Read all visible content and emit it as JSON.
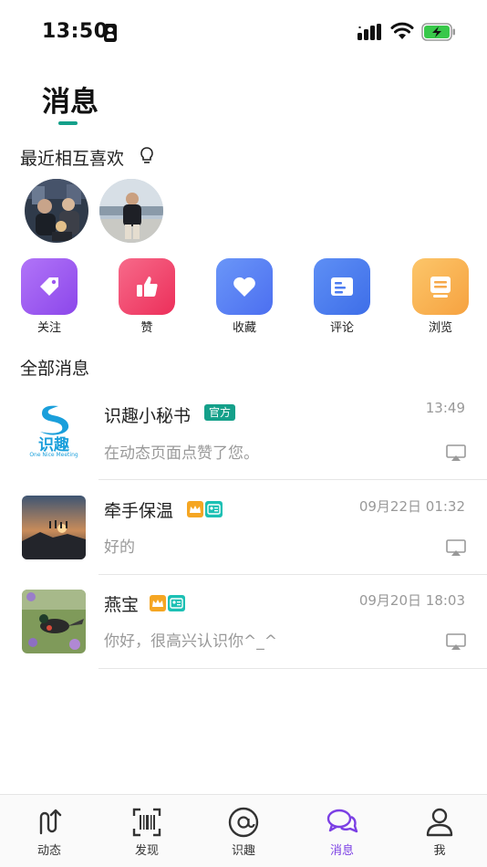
{
  "status_bar": {
    "time": "13:50"
  },
  "header": {
    "title": "消息"
  },
  "mutual_likes": {
    "title": "最近相互喜欢"
  },
  "categories": [
    {
      "label": "关注",
      "icon": "tag-icon",
      "color": "#a05ef2"
    },
    {
      "label": "赞",
      "icon": "thumbs-up-icon",
      "color": "#f04a6e"
    },
    {
      "label": "收藏",
      "icon": "heart-icon",
      "color": "#5a84f5"
    },
    {
      "label": "评论",
      "icon": "comment-card-icon",
      "color": "#4f80f0"
    },
    {
      "label": "浏览",
      "icon": "browse-card-icon",
      "color": "#f9b154"
    }
  ],
  "all_messages": {
    "title": "全部消息"
  },
  "messages": [
    {
      "name": "识趣小秘书",
      "badge": "官方",
      "time": "13:49",
      "text": "在动态页面点赞了您。",
      "logo_text": "识趣",
      "logo_subtitle": "One Nice Meeting"
    },
    {
      "name": "牵手保温",
      "time": "09月22日 01:32",
      "text": "好的"
    },
    {
      "name": "燕宝",
      "time": "09月20日 18:03",
      "text": "你好，很高兴认识你^_^"
    }
  ],
  "tabs": [
    {
      "label": "动态",
      "icon": "dynamic-icon"
    },
    {
      "label": "发现",
      "icon": "barcode-scan-icon"
    },
    {
      "label": "识趣",
      "icon": "at-sign-icon"
    },
    {
      "label": "消息",
      "icon": "chat-bubbles-icon",
      "active": true
    },
    {
      "label": "我",
      "icon": "person-icon"
    }
  ],
  "colors": {
    "accent": "#14a08a",
    "active_tab": "#7b3fe4"
  }
}
